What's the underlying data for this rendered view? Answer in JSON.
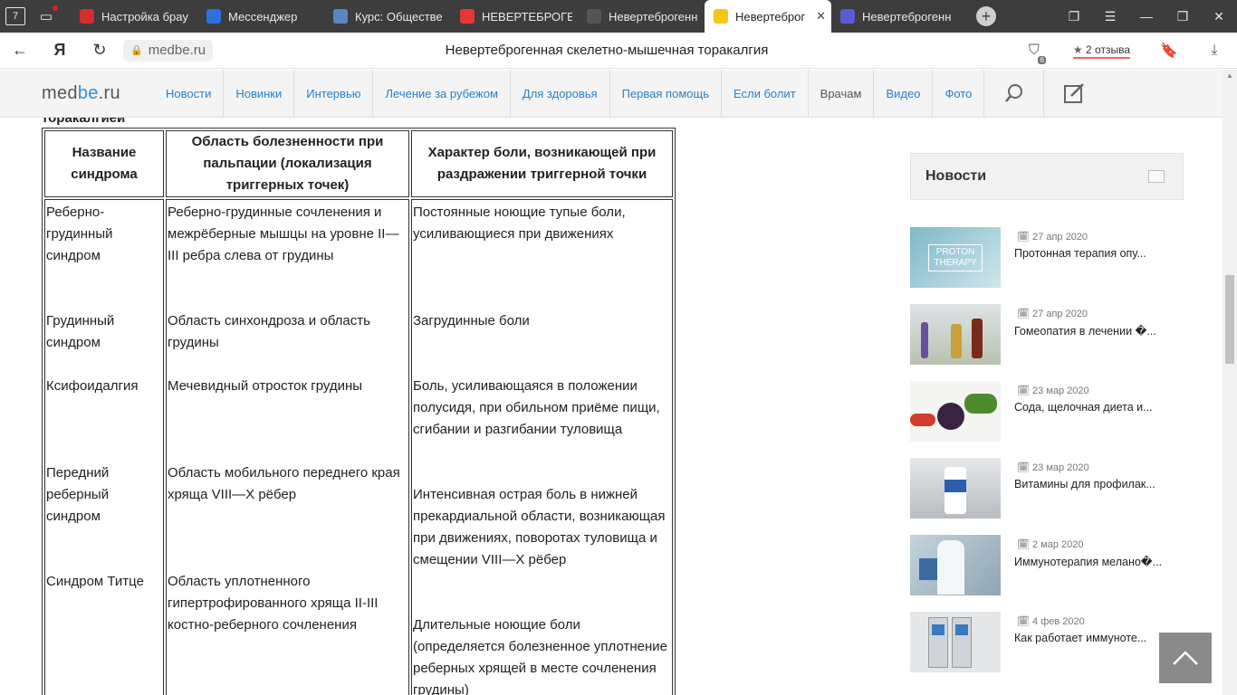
{
  "browser": {
    "tab_counter": "7",
    "tabs": [
      {
        "label": "Настройка брау",
        "favicon": "yandex-browser-icon",
        "color": "#d32f2f"
      },
      {
        "label": "Мессенджер",
        "favicon": "messenger-icon",
        "color": "#2f6fe0"
      },
      {
        "label": "Курс: Обществе",
        "favicon": "course-icon",
        "color": "#5a87c4"
      },
      {
        "label": "НЕВЕРТЕБРОГЕНН",
        "favicon": "yandex-icon",
        "color": "#e53935"
      },
      {
        "label": "Невертеброгенн",
        "favicon": "globe-icon",
        "color": "#555555"
      },
      {
        "label": "Невертеброг",
        "favicon": "medbe-icon",
        "color": "#f5c518",
        "active": true
      },
      {
        "label": "Невертеброгенн",
        "favicon": "avatar-icon",
        "color": "#5b5bd6"
      }
    ],
    "url": "medbe.ru",
    "page_title": "Невертеброгенная скелетно-мышечная торакалгия",
    "reviews": "2 отзыва",
    "download_badge": "6"
  },
  "site": {
    "logo_med": "med",
    "logo_be": "be",
    "logo_ru": ".ru",
    "nav": [
      "Новости",
      "Новинки",
      "Интервью",
      "Лечение за рубежом",
      "Для здоровья",
      "Первая помощь",
      "Если болит",
      "Врачам",
      "Видео",
      "Фото"
    ]
  },
  "article": {
    "cut_heading": "торакалгией",
    "headers": [
      "Название синдрома",
      "Область болезненности при пальпации (локализация триггерных точек)",
      "Характер боли, возникающей при раздражении триггерной точки"
    ],
    "rows": [
      {
        "name": "Реберно-грудинный синдром",
        "area": "Реберно-грудинные сочленения и межрёберные мышцы на уровне II—III ребра слева от грудины",
        "pain": "Постоянные ноющие тупые боли, усиливающиеся при движениях"
      },
      {
        "name": "Грудинный синдром",
        "area": "Область синхондроза и область грудины",
        "pain": "Загрудинные боли"
      },
      {
        "name": "Ксифоидалгия",
        "area": "Мечевидный отросток грудины",
        "pain": "Боль, усиливающаяся в положении полусидя, при обильном приёме пищи, сгибании и разгибании туловища"
      },
      {
        "name": "Передний реберный синдром",
        "area": "Область мобильного переднего края хряща VIII—X рёбер",
        "pain": "Интенсивная острая боль в нижней прекардиальной области, возникающая при движениях, поворотах туловища и смещении VIII—X рёбер"
      },
      {
        "name": "Синдром Титце",
        "area": "Область уплотненного гипертрофированного хряща II-III костно-реберного сочленения",
        "pain": "Длительные ноющие боли (определяется болезненное уплотнение реберных хрящей в месте сочленения грудины)"
      }
    ]
  },
  "sidebar": {
    "title": "Новости",
    "items": [
      {
        "date": "27 апр 2020",
        "text": "Протонная терапия опу..."
      },
      {
        "date": "27 апр 2020",
        "text": "Гомеопатия в лечении �..."
      },
      {
        "date": "23 мар 2020",
        "text": "Сода, щелочная диета и..."
      },
      {
        "date": "23 мар 2020",
        "text": "Витамины для профилак..."
      },
      {
        "date": "2 мар 2020",
        "text": "Иммунотерапия мелано�..."
      },
      {
        "date": "4 фев 2020",
        "text": "Как работает иммуноте..."
      }
    ],
    "thumb_caption": "PROTON THERAPY"
  }
}
